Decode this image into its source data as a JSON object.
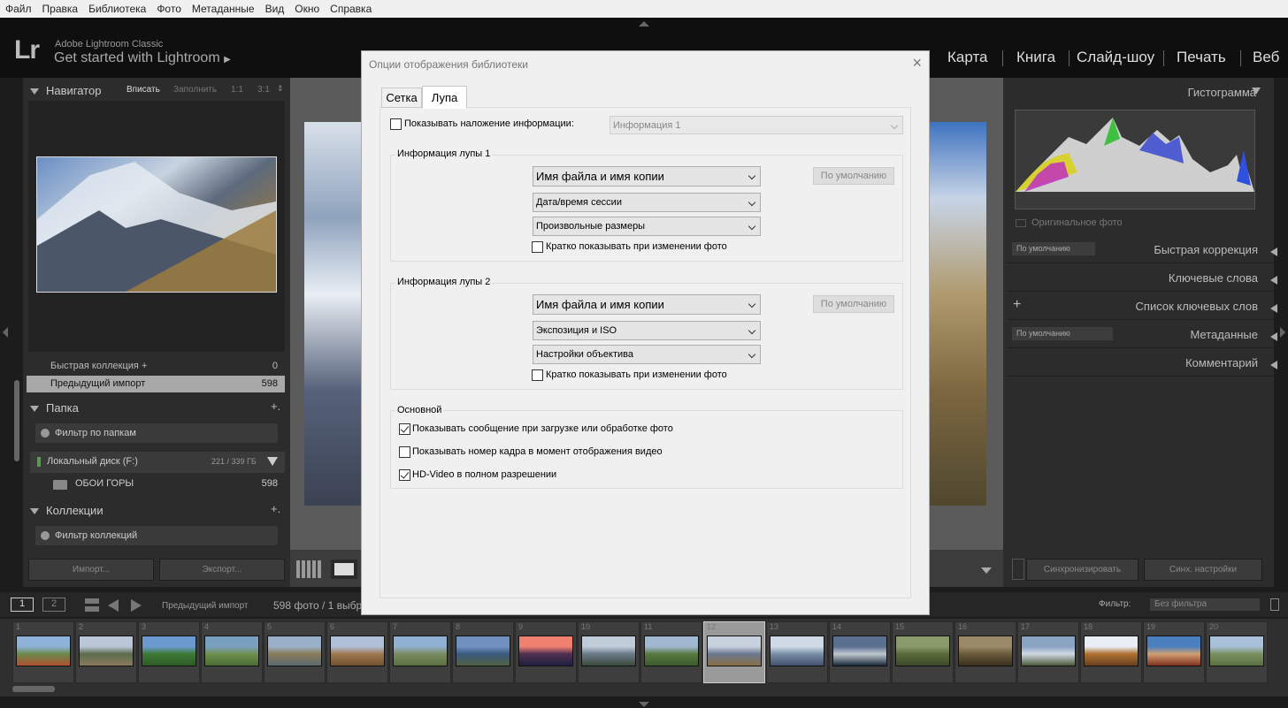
{
  "menu": [
    "Файл",
    "Правка",
    "Библиотека",
    "Фото",
    "Метаданные",
    "Вид",
    "Окно",
    "Справка"
  ],
  "brand": {
    "logo": "Lr",
    "small": "Adobe Lightroom Classic",
    "big": "Get started with Lightroom",
    "arrow": "▶"
  },
  "modules": [
    "Карта",
    "Книга",
    "Слайд-шоу",
    "Печать",
    "Веб"
  ],
  "navigator": {
    "title": "Навигатор",
    "options": [
      "Вписать",
      "Заполнить",
      "1:1",
      "3:1"
    ]
  },
  "catalog": [
    {
      "label": "Быстрая коллекция +",
      "count": "0"
    },
    {
      "label": "Предыдущий импорт",
      "count": "598"
    }
  ],
  "folders": {
    "title": "Папка",
    "plus": "+.",
    "filter": "Фильтр по папкам",
    "drive": "Локальный диск (F:)",
    "drive_usage": "221 / 339 ГБ",
    "folder": "ОБОИ ГОРЫ",
    "folder_count": "598"
  },
  "collections": {
    "title": "Коллекции",
    "plus": "+.",
    "filter": "Фильтр коллекций"
  },
  "left_buttons": {
    "import": "Импорт...",
    "export": "Экспорт..."
  },
  "right": {
    "histogram": "Гистограмма",
    "original_photo": "Оригинальное фото",
    "quick_dev_preset": "По умолчанию",
    "quick_dev": "Быстрая коррекция",
    "keywording": "Ключевые слова",
    "keyword_list": "Список ключевых слов",
    "meta_preset": "По умолчанию",
    "metadata": "Метаданные",
    "comments": "Комментарий",
    "sync": "Синхронизировать",
    "sync_settings": "Синх. настройки"
  },
  "filmbar": {
    "page1": "1",
    "page2": "2",
    "source": "Предыдущий импорт",
    "count": "598 фото / 1 выбра",
    "filter_label": "Фильтр:",
    "filter_value": "Без фильтра"
  },
  "film_numbers": [
    "1",
    "2",
    "3",
    "4",
    "5",
    "6",
    "7",
    "8",
    "9",
    "10",
    "11",
    "12",
    "13",
    "14",
    "15",
    "16",
    "17",
    "18",
    "19",
    "20"
  ],
  "dialog": {
    "title": "Опции отображения библиотеки",
    "close": "×",
    "tabs": [
      "Сетка",
      "Лупа"
    ],
    "overlay": {
      "label": "Показывать наложение информации:",
      "value": "Информация 1"
    },
    "loupe1": {
      "title": "Информация лупы 1",
      "fields": [
        "Имя файла и имя копии",
        "Дата/время сессии",
        "Произвольные размеры"
      ],
      "default_btn": "По умолчанию",
      "brief": "Кратко показывать при изменении фото"
    },
    "loupe2": {
      "title": "Информация лупы 2",
      "fields": [
        "Имя файла и имя копии",
        "Экспозиция и ISO",
        "Настройки объектива"
      ],
      "default_btn": "По умолчанию",
      "brief": "Кратко показывать при изменении фото"
    },
    "general": {
      "title": "Основной",
      "options": [
        {
          "label": "Показывать сообщение при загрузке или обработке фото",
          "checked": true
        },
        {
          "label": "Показывать номер кадра в момент отображения видео",
          "checked": false
        },
        {
          "label": "HD-Video в полном разрешении",
          "checked": true
        }
      ]
    }
  },
  "colors": {
    "selected_row": "#a8a8a8",
    "panel": "#2c2c2c",
    "dialog_bg": "#f0f0f0"
  }
}
